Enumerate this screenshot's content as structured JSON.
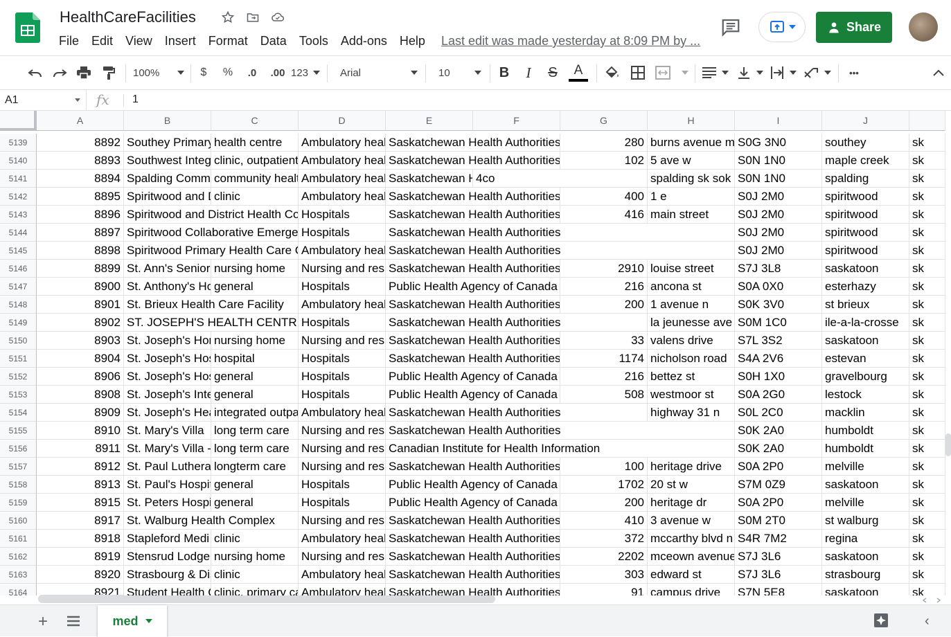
{
  "app": {
    "doc_title": "HealthCareFacilities",
    "menu": [
      "File",
      "Edit",
      "View",
      "Insert",
      "Format",
      "Data",
      "Tools",
      "Add-ons",
      "Help"
    ],
    "last_edit": "Last edit was made yesterday at 8:09 PM by ...",
    "share_label": "Share",
    "brand_color": "#188038"
  },
  "toolbar": {
    "zoom": "100%",
    "currency": "$",
    "percent": "%",
    "dec_less": ".0",
    "dec_more": ".00",
    "more_formats": "123",
    "font": "Arial",
    "font_size": "10",
    "bold": "B",
    "italic": "I",
    "strike": "S",
    "text_color": "A",
    "more": "•••"
  },
  "formula": {
    "namebox": "A1",
    "fx": "fx",
    "value": "1"
  },
  "grid": {
    "columns": [
      "A",
      "B",
      "C",
      "D",
      "E",
      "F",
      "G",
      "H",
      "I",
      "J",
      ""
    ],
    "rows": [
      {
        "n": "5139",
        "cells": [
          "8892",
          "Southey Primary",
          "health centre",
          "Ambulatory heal",
          "Saskatchewan Health Authorities",
          "",
          "280",
          "burns avenue ma",
          "S0G 3N0",
          "southey",
          "sk"
        ]
      },
      {
        "n": "5140",
        "cells": [
          "8893",
          "Southwest Integ",
          "clinic, outpatient",
          "Ambulatory heal",
          "Saskatchewan Health Authorities",
          "",
          "102",
          "5 ave w",
          "S0N 1N0",
          "maple creek",
          "sk"
        ]
      },
      {
        "n": "5141",
        "cells": [
          "8894",
          "Spalding Commu",
          "community healt",
          "Ambulatory heal",
          "Saskatchewan Health Authorities",
          "4co",
          "",
          "spalding sk sok",
          "S0N 1N0",
          "spalding",
          "sk"
        ]
      },
      {
        "n": "5142",
        "cells": [
          "8895",
          "Spiritwood and D",
          "clinic",
          "Ambulatory heal",
          "Saskatchewan Health Authorities",
          "",
          "400",
          "1 e",
          "S0J 2M0",
          "spiritwood",
          "sk"
        ]
      },
      {
        "n": "5143",
        "cells": [
          "8896",
          "Spiritwood and District Health Cor",
          "",
          "Hospitals",
          "Saskatchewan Health Authorities",
          "",
          "416",
          "main street",
          "S0J 2M0",
          "spiritwood",
          "sk"
        ]
      },
      {
        "n": "5144",
        "cells": [
          "8897",
          "Spiritwood Collaborative Emergen",
          "",
          "Hospitals",
          "Saskatchewan Health Authorities",
          "",
          "",
          "",
          "S0J 2M0",
          "spiritwood",
          "sk"
        ]
      },
      {
        "n": "5145",
        "cells": [
          "8898",
          "Spiritwood Primary Health Care C",
          "",
          "Ambulatory heal",
          "Saskatchewan Health Authorities",
          "",
          "",
          "",
          "S0J 2M0",
          "spiritwood",
          "sk"
        ]
      },
      {
        "n": "5146",
        "cells": [
          "8899",
          "St. Ann's Senior",
          "nursing home",
          "Nursing and resi",
          "Saskatchewan Health Authorities",
          "",
          "2910",
          "louise street",
          "S7J 3L8",
          "saskatoon",
          "sk"
        ]
      },
      {
        "n": "5147",
        "cells": [
          "8900",
          "St. Anthony's Ho",
          "general",
          "Hospitals",
          "Public Health Agency of Canada",
          "",
          "216",
          "ancona st",
          "S0A 0X0",
          "esterhazy",
          "sk"
        ]
      },
      {
        "n": "5148",
        "cells": [
          "8901",
          "St. Brieux Health Care Facility",
          "",
          "Ambulatory heal",
          "Saskatchewan Health Authorities",
          "",
          "200",
          "1 avenue n",
          "S0K 3V0",
          "st brieux",
          "sk"
        ]
      },
      {
        "n": "5149",
        "cells": [
          "8902",
          "ST. JOSEPH'S HEALTH CENTRE",
          "",
          "Hospitals",
          "Saskatchewan Health Authorities",
          "",
          "",
          "la jeunesse ave",
          "S0M 1C0",
          "ile-a-la-crosse",
          "sk"
        ]
      },
      {
        "n": "5150",
        "cells": [
          "8903",
          "St. Joseph's Hor",
          "nursing home",
          "Nursing and resi",
          "Saskatchewan Health Authorities",
          "",
          "33",
          "valens drive",
          "S7L 3S2",
          "saskatoon",
          "sk"
        ]
      },
      {
        "n": "5151",
        "cells": [
          "8904",
          "St. Joseph's Hos",
          "hospital",
          "Hospitals",
          "Saskatchewan Health Authorities",
          "",
          "1174",
          "nicholson road",
          "S4A 2V6",
          "estevan",
          "sk"
        ]
      },
      {
        "n": "5152",
        "cells": [
          "8906",
          "St. Joseph's Hos",
          "general",
          "Hospitals",
          "Public Health Agency of Canada",
          "",
          "216",
          "bettez st",
          "S0H 1X0",
          "gravelbourg",
          "sk"
        ]
      },
      {
        "n": "5153",
        "cells": [
          "8908",
          "St. Joseph's Inte",
          "general",
          "Hospitals",
          "Public Health Agency of Canada",
          "",
          "508",
          "westmoor st",
          "S0A 2G0",
          "lestock",
          "sk"
        ]
      },
      {
        "n": "5154",
        "cells": [
          "8909",
          "St. Joseph's Hea",
          "integrated outpa",
          "Ambulatory heal",
          "Saskatchewan Health Authorities",
          "",
          "",
          "highway 31 n",
          "S0L 2C0",
          "macklin",
          "sk"
        ]
      },
      {
        "n": "5155",
        "cells": [
          "8910",
          "St. Mary's Villa",
          "long term care",
          "Nursing and resi",
          "Saskatchewan Health Authorities",
          "",
          "",
          "",
          "S0K 2A0",
          "humboldt",
          "sk"
        ]
      },
      {
        "n": "5156",
        "cells": [
          "8911",
          "St. Mary's Villa -",
          "long term care",
          "Nursing and resi",
          "Canadian Institute for Health Information",
          "",
          "",
          "",
          "S0K 2A0",
          "humboldt",
          "sk"
        ]
      },
      {
        "n": "5157",
        "cells": [
          "8912",
          "St. Paul Luthera",
          "longterm care",
          "Nursing and resi",
          "Saskatchewan Health Authorities",
          "",
          "100",
          "heritage drive",
          "S0A 2P0",
          "melville",
          "sk"
        ]
      },
      {
        "n": "5158",
        "cells": [
          "8913",
          "St. Paul's Hospit",
          "general",
          "Hospitals",
          "Public Health Agency of Canada",
          "",
          "1702",
          "20 st w",
          "S7M 0Z9",
          "saskatoon",
          "sk"
        ]
      },
      {
        "n": "5159",
        "cells": [
          "8915",
          "St. Peters Hospi",
          "general",
          "Hospitals",
          "Public Health Agency of Canada",
          "",
          "200",
          "heritage dr",
          "S0A 2P0",
          "melville",
          "sk"
        ]
      },
      {
        "n": "5160",
        "cells": [
          "8917",
          "St. Walburg Health Complex",
          "",
          "Nursing and resi",
          "Saskatchewan Health Authorities",
          "",
          "410",
          "3 avenue w",
          "S0M 2T0",
          "st walburg",
          "sk"
        ]
      },
      {
        "n": "5161",
        "cells": [
          "8918",
          "Stapleford Medi",
          "clinic",
          "Ambulatory heal",
          "Saskatchewan Health Authorities",
          "",
          "372",
          "mccarthy blvd n",
          "S4R 7M2",
          "regina",
          "sk"
        ]
      },
      {
        "n": "5162",
        "cells": [
          "8919",
          "Stensrud Lodge",
          "nursing home",
          "Nursing and resi",
          "Saskatchewan Health Authorities",
          "",
          "2202",
          "mceown avenue",
          "S7J 3L6",
          "saskatoon",
          "sk"
        ]
      },
      {
        "n": "5163",
        "cells": [
          "8920",
          "Strasbourg & Dis",
          "clinic",
          "Ambulatory heal",
          "Saskatchewan Health Authorities",
          "",
          "303",
          "edward st",
          "S7J 3L6",
          "strasbourg",
          "sk"
        ]
      },
      {
        "n": "5164",
        "cells": [
          "8921",
          "Student Health C",
          "clinic, primary ca",
          "Ambulatory heal",
          "Saskatchewan Health Authorities",
          "",
          "91",
          "campus drive",
          "S7N 5E8",
          "saskatoon",
          "sk"
        ]
      }
    ]
  },
  "sheets": {
    "active": "med"
  }
}
